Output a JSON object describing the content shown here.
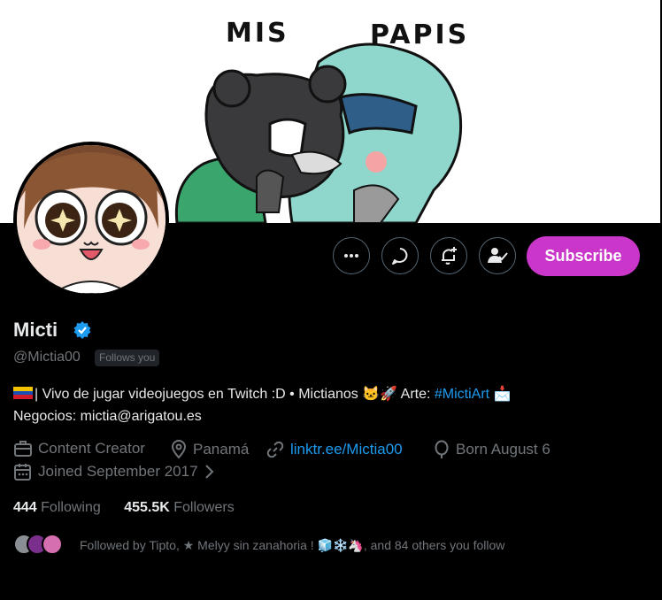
{
  "banner": {
    "text_left": "MIS",
    "text_right": "PAPIS"
  },
  "actions": {
    "more_icon": "ellipsis-icon",
    "message_icon": "message-icon",
    "notify_icon": "bell-plus-icon",
    "following_icon": "person-check-icon",
    "subscribe_label": "Subscribe",
    "subscribe_color": "#c936c9"
  },
  "profile": {
    "name": "Micti",
    "handle": "@Mictia00",
    "follows_you": "Follows you",
    "bio_line1_prefix": "| Vivo de jugar videojuegos en Twitch :D • Mictianos 🐱🚀 Arte: ",
    "bio_hashtag": "#MictiArt",
    "bio_line1_suffix": " 📩",
    "bio_line2": "Negocios: mictia@arigatou.es",
    "category": "Content Creator",
    "location": "Panamá",
    "website": "linktr.ee/Mictia00",
    "birthday": "Born August 6",
    "joined": "Joined September 2017"
  },
  "stats": {
    "following_count": "444",
    "following_label": "Following",
    "followers_count": "455.5K",
    "followers_label": "Followers"
  },
  "followed_by": "Followed by Tipto, ★ Melyy sin zanahoria ! 🧊❄️🦄, and 84 others you follow"
}
